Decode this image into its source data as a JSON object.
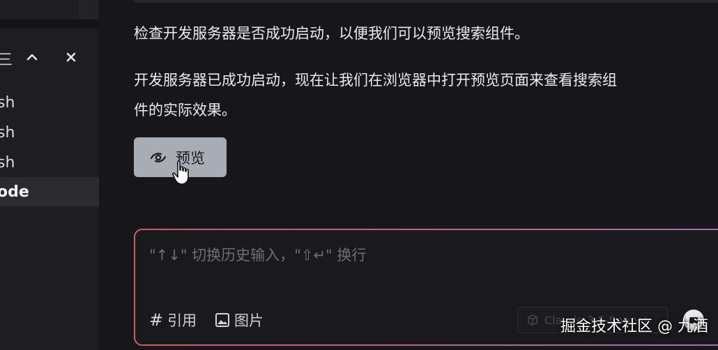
{
  "terminal_panel": {
    "header_partial": "三",
    "items": [
      {
        "label": "sh",
        "active": false
      },
      {
        "label": "sh",
        "active": false
      },
      {
        "label": "sh",
        "active": false
      },
      {
        "label": "ode",
        "active": true
      }
    ]
  },
  "chat": {
    "messages": [
      "检查开发服务器是否成功启动，以便我们可以预览搜索组件。",
      "开发服务器已成功启动，现在让我们在浏览器中打开预览页面来查看搜索组",
      "件的实际效果。"
    ],
    "preview_button": "预览"
  },
  "composer": {
    "placeholder": "\"↑↓\" 切换历史输入，\"⇧↵\" 换行",
    "quote_label": "引用",
    "image_label": "图片",
    "model_label": "Claude-3.5-Sonnet",
    "quote_icon": "hash-icon",
    "image_icon": "image-icon"
  },
  "watermark": "掘金技术社区 @ 九酒",
  "colors": {
    "background": "#17171b",
    "panel": "#1e1e22",
    "active_item": "#2b2b32",
    "preview_button": "#a8acb5",
    "composer_border_start": "#c9606a",
    "composer_border_end": "#a46fb0"
  }
}
